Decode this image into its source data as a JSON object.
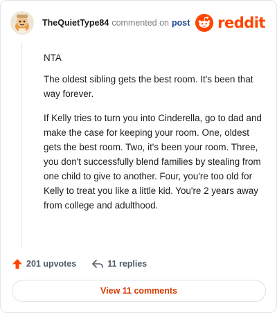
{
  "header": {
    "username": "TheQuietType84",
    "commented_text": "commented on",
    "post_link": "post",
    "logo_text": "reddit",
    "avatar_icon": "snoo-avatar-icon",
    "logo_icon": "reddit-snoo-icon"
  },
  "comment": {
    "paragraphs": [
      "NTA",
      "The oldest sibling gets the best room. It's been that way forever.",
      "If Kelly tries to turn you into Cinderella, go to dad and make the case for keeping your room. One, oldest gets the best room. Two, it's been your room. Three, you don't successfully blend families by stealing from one child to give to another. Four, you're too old for Kelly to treat you like a little kid. You're 2 years away from college and adulthood."
    ]
  },
  "actions": {
    "upvotes": "201 upvotes",
    "replies": "11 replies",
    "upvote_icon": "upvote-arrow-icon",
    "reply_icon": "reply-arrow-icon"
  },
  "footer": {
    "view_comments": "View 11 comments"
  },
  "colors": {
    "brand": "#ff4500",
    "link": "#1c4a8c",
    "view_button_text": "#d93900"
  }
}
